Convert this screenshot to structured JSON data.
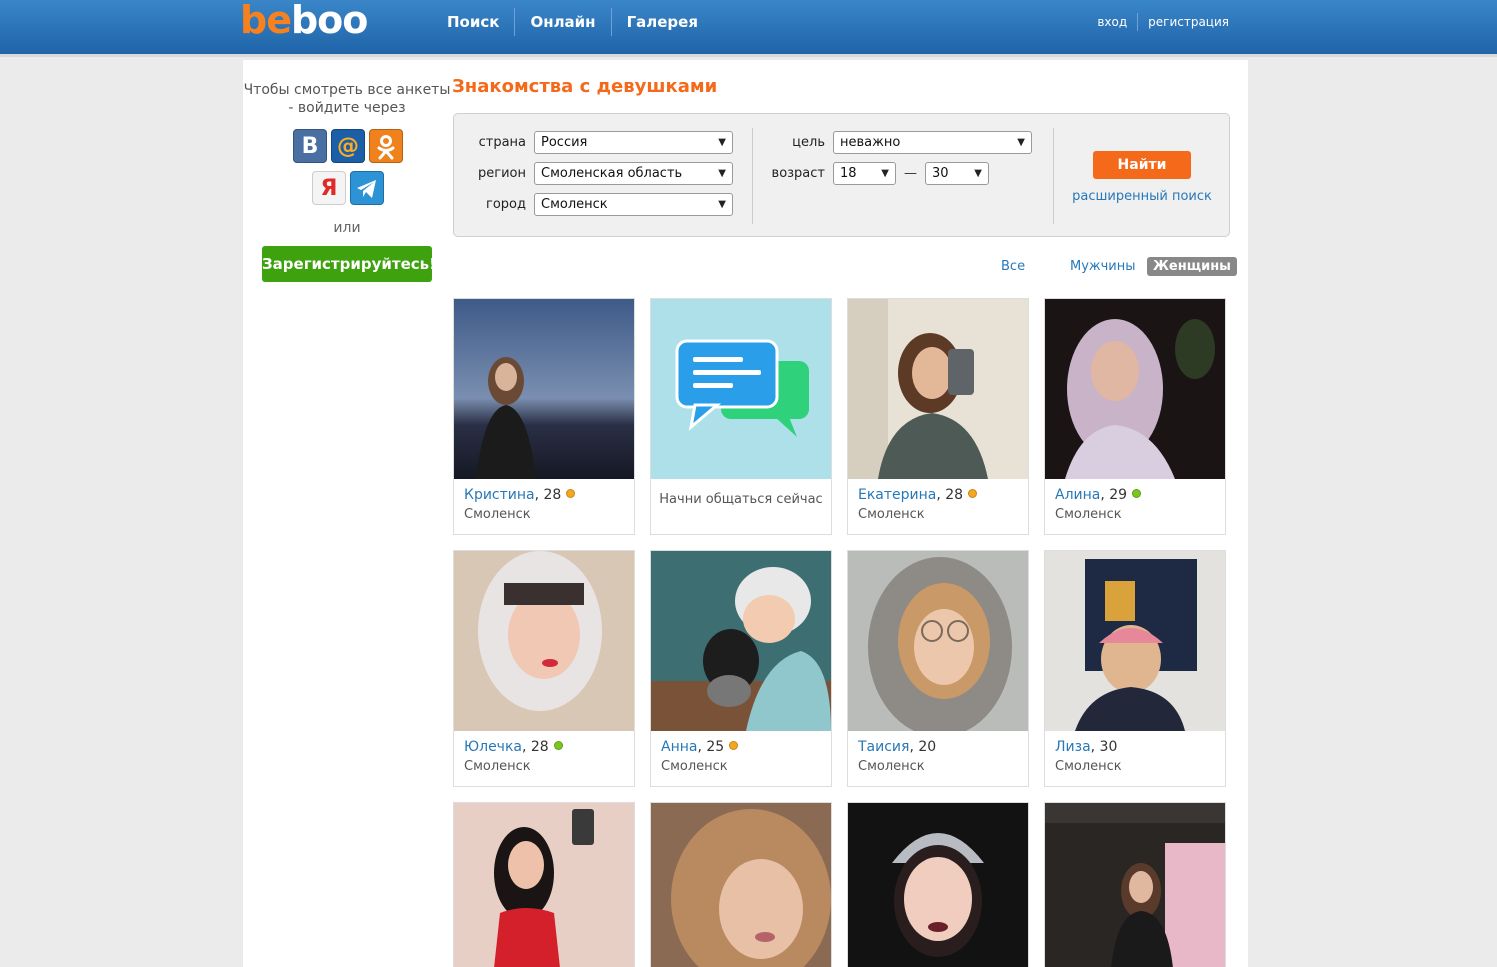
{
  "header": {
    "logo": {
      "part1": "be",
      "part2": "boo"
    },
    "nav": [
      "Поиск",
      "Онлайн",
      "Галерея"
    ],
    "auth": {
      "login": "вход",
      "register": "регистрация"
    }
  },
  "sidebar": {
    "hint": "Чтобы смотреть все анкеты - войдите через",
    "social": {
      "vk": "В",
      "mail": "@",
      "ok": "ok-icon",
      "yandex": "Я",
      "telegram": "telegram-icon"
    },
    "or": "или",
    "register_button": "Зарегистрируйтесь!"
  },
  "main": {
    "title": "Знакомства с девушками",
    "search": {
      "country_label": "страна",
      "country_value": "Россия",
      "region_label": "регион",
      "region_value": "Смоленская область",
      "city_label": "город",
      "city_value": "Смоленск",
      "goal_label": "цель",
      "goal_value": "неважно",
      "age_label": "возраст",
      "age_from": "18",
      "age_dash": "—",
      "age_to": "30",
      "find_button": "Найти",
      "advanced_link": "расширенный поиск"
    },
    "gender_filter": {
      "all": "Все",
      "men": "Мужчины",
      "women": "Женщины",
      "selected": "Женщины"
    },
    "promo": {
      "text": "Начни общаться сейчас"
    },
    "profiles": [
      {
        "name": "Кристина",
        "age": ", 28",
        "status": "orange",
        "city": "Смоленск"
      },
      {
        "name": "Екатерина",
        "age": ", 28",
        "status": "orange",
        "city": "Смоленск"
      },
      {
        "name": "Алина",
        "age": ", 29",
        "status": "green",
        "city": "Смоленск"
      },
      {
        "name": "Юлечка",
        "age": ", 28",
        "status": "green",
        "city": "Смоленск"
      },
      {
        "name": "Анна",
        "age": ", 25",
        "status": "orange",
        "city": "Смоленск"
      },
      {
        "name": "Таисия",
        "age": ", 20",
        "status": "",
        "city": "Смоленск"
      },
      {
        "name": "Лиза",
        "age": ", 30",
        "status": "",
        "city": "Смоленск"
      }
    ],
    "colors": {
      "accent": "#f46a1a",
      "link": "#2878b8",
      "register_green": "#3ea10e",
      "header_blue": "#2a74ba"
    }
  }
}
